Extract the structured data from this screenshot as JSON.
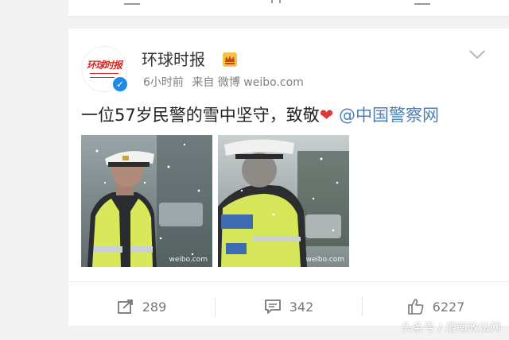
{
  "post": {
    "author": {
      "name": "环球时报",
      "avatar_text": "环球时报",
      "avatar_subtext": "HUANQIU SHIBAO",
      "verified": true,
      "badge_icon": "crown-icon"
    },
    "time": "6小时前",
    "source": "来自 微博 weibo.com",
    "text_main": "一位57岁民警的雪中坚守，致敬",
    "text_emoji": "❤",
    "mention": "@中国警察网",
    "images": [
      {
        "description_icon": "police-officer-photo",
        "watermark": "weibo.com"
      },
      {
        "description_icon": "police-officer-back-photo",
        "watermark": "weibo.com"
      }
    ]
  },
  "actions": {
    "repost_count": "289",
    "comment_count": "342",
    "like_count": "6227"
  },
  "footer_watermark": "头条号 / 渭南政法网",
  "colors": {
    "mention": "#4f7fb3",
    "verified": "#1e8ae6",
    "brand_red": "#d42a23",
    "heart": "#e03636"
  }
}
